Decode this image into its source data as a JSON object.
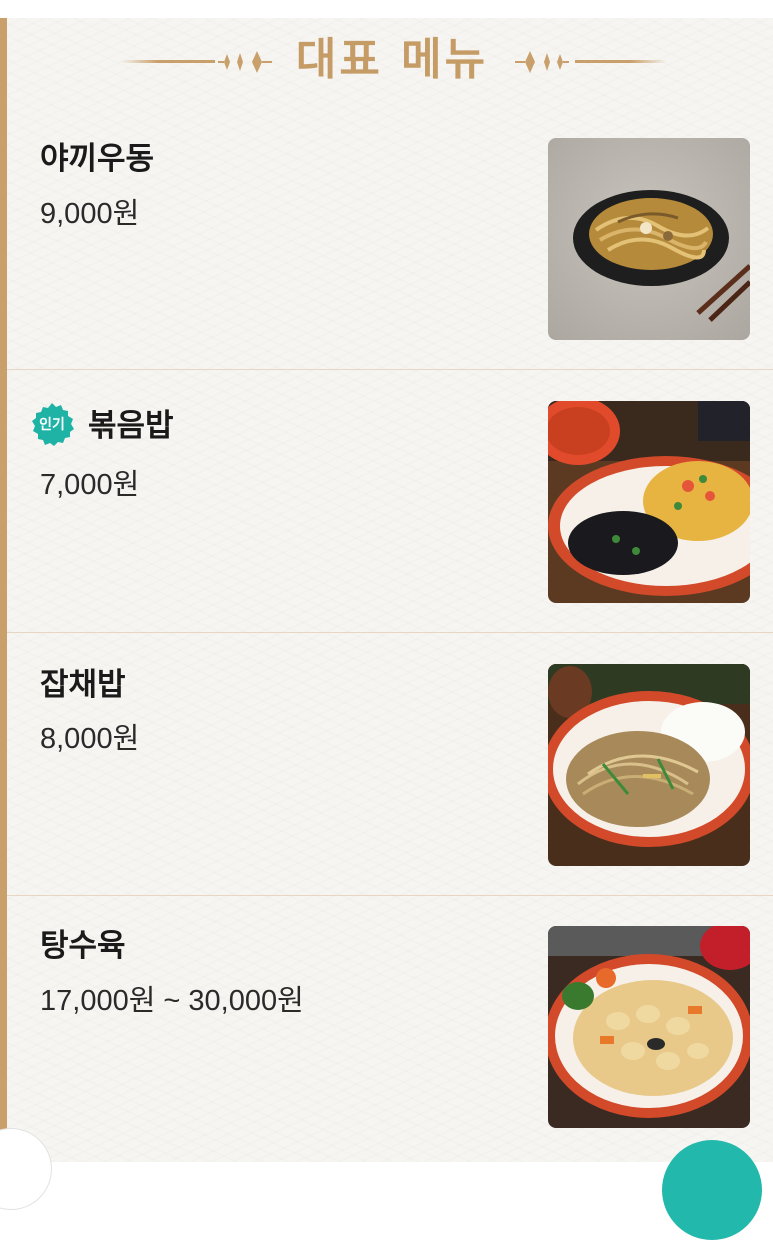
{
  "header": {
    "title": "대표 메뉴"
  },
  "menu": {
    "items": [
      {
        "name": "야끼우동",
        "price": "9,000원",
        "image": "yaki-udon-photo"
      },
      {
        "name": "볶음밥",
        "price": "7,000원",
        "badge": "인기",
        "image": "fried-rice-photo"
      },
      {
        "name": "잡채밥",
        "price": "8,000원",
        "image": "japchae-rice-photo"
      },
      {
        "name": "탕수육",
        "price": "17,000원 ~ 30,000원",
        "image": "sweet-sour-pork-photo"
      }
    ]
  },
  "colors": {
    "accent_gold": "#c59c66",
    "badge_teal": "#1fb3a6",
    "divider": "#e8d6c4",
    "panel_bg": "#f6f5f2"
  },
  "icons": [
    "diamond-ornament-icon",
    "popular-badge-icon",
    "floating-action-button"
  ]
}
